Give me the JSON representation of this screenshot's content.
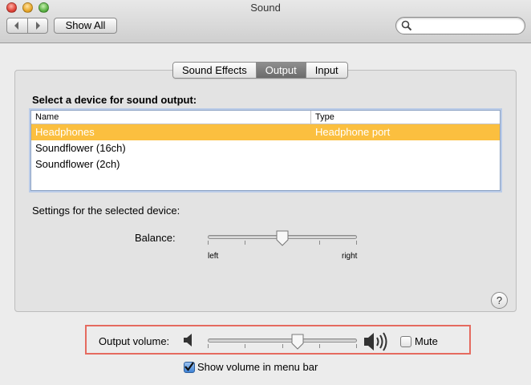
{
  "window": {
    "title": "Sound"
  },
  "toolbar": {
    "back_icon": "chevron-left-icon",
    "forward_icon": "chevron-right-icon",
    "show_all_label": "Show All",
    "search_placeholder": "",
    "search_icon": "magnifier-icon"
  },
  "tabs": [
    {
      "label": "Sound Effects",
      "active": false
    },
    {
      "label": "Output",
      "active": true
    },
    {
      "label": "Input",
      "active": false
    }
  ],
  "device_section": {
    "title": "Select a device for sound output:",
    "columns": [
      "Name",
      "Type"
    ],
    "rows": [
      {
        "name": "Headphones",
        "type": "Headphone port",
        "selected": true
      },
      {
        "name": "Soundflower (16ch)",
        "type": "",
        "selected": false
      },
      {
        "name": "Soundflower (2ch)",
        "type": "",
        "selected": false
      }
    ],
    "selection_color": "#fbbf3f"
  },
  "settings": {
    "label": "Settings for the selected device:",
    "balance_label": "Balance:",
    "balance_value": 0.5,
    "left_label": "left",
    "right_label": "right"
  },
  "help_label": "?",
  "volume": {
    "label": "Output volume:",
    "value": 0.6,
    "low_icon": "speaker-low-icon",
    "high_icon": "speaker-high-icon",
    "mute_label": "Mute",
    "mute_checked": false,
    "highlight_color": "#e56a5f"
  },
  "menu_bar": {
    "label": "Show volume in menu bar",
    "checked": true
  }
}
